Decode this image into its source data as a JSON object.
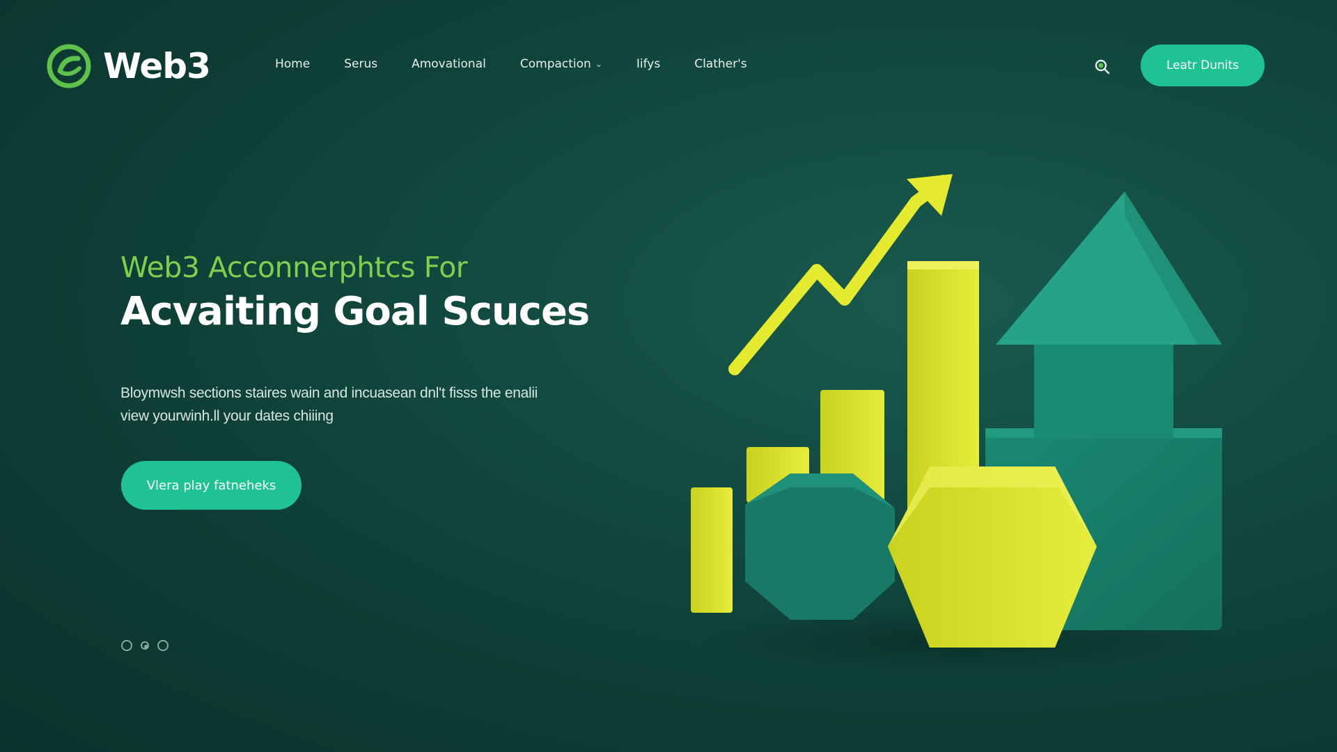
{
  "brand": {
    "name": "Web3"
  },
  "nav": {
    "items": [
      {
        "label": "Home"
      },
      {
        "label": "Serus"
      },
      {
        "label": "Amovational"
      },
      {
        "label": "Compaction",
        "has_dropdown": true
      },
      {
        "label": "Iifys"
      },
      {
        "label": "Clather's"
      }
    ]
  },
  "header": {
    "cta_label": "Leatr Dunits",
    "search_icon": "search-icon"
  },
  "hero": {
    "eyebrow": "Web3 Acconnerphtcs For",
    "title": "Acvaiting Goal Scuces",
    "description": "Bloymwsh sections staires wain and incuasean dnl't fisss the enalii view yourwinh.ll your dates chiiing",
    "cta_label": "Vlera play fatneheks"
  },
  "carousel": {
    "slide_count": 3,
    "active_index": 1
  },
  "colors": {
    "accent": "#1fc293",
    "eyebrow": "#7fcf4e",
    "yellow": "#dfe52a",
    "teal_shape": "#1d8c74",
    "background": "#0d3b33"
  }
}
